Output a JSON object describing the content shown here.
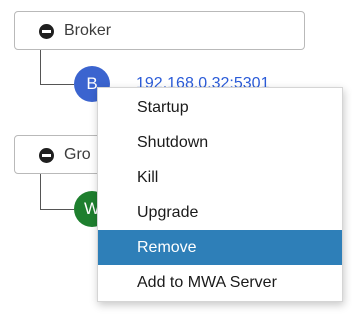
{
  "groups": [
    {
      "label": "Broker"
    },
    {
      "label": "Gro"
    }
  ],
  "nodes": [
    {
      "avatar_letter": "B",
      "link_text": "192.168.0.32:5301",
      "avatar_color": "#3b64cf"
    },
    {
      "avatar_letter": "W",
      "avatar_color": "#1e7f2e"
    }
  ],
  "context_menu": {
    "items": [
      {
        "label": "Startup"
      },
      {
        "label": "Shutdown"
      },
      {
        "label": "Kill"
      },
      {
        "label": "Upgrade"
      },
      {
        "label": "Remove",
        "state": "highlighted"
      },
      {
        "label": "Add to MWA Server"
      }
    ],
    "highlight_color": "#2e7fb8"
  }
}
